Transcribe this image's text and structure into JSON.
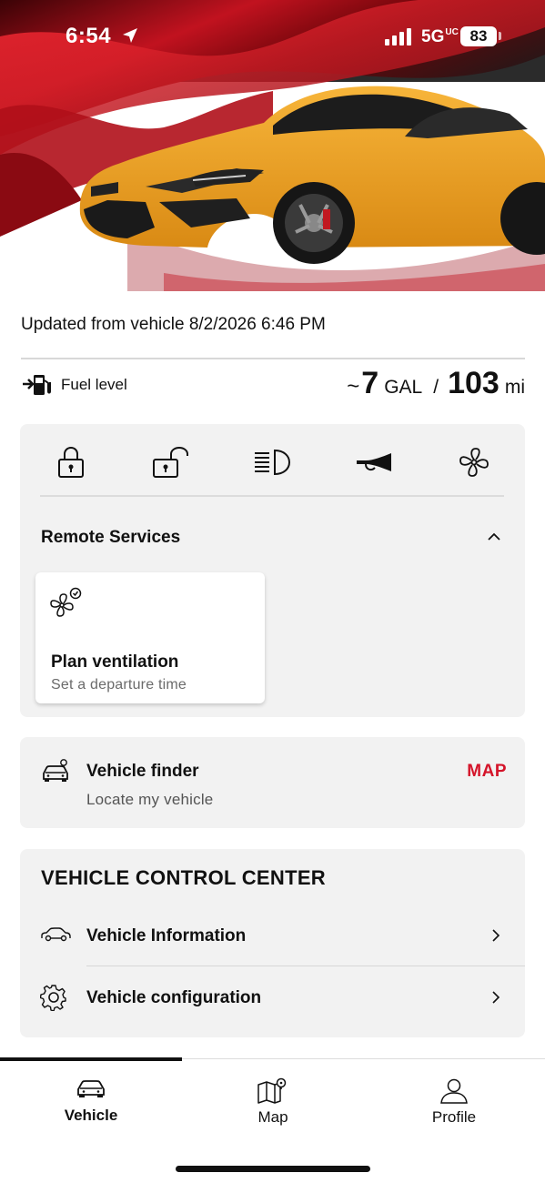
{
  "status_bar": {
    "time": "6:54",
    "network": "5G",
    "network_suffix": "UC",
    "battery": "83"
  },
  "hero": {
    "car_color": "#f2a420",
    "accent_color": "#d4142a"
  },
  "vehicle": {
    "updated_text": "Updated from vehicle 8/2/2026 6:46 PM",
    "fuel_label": "Fuel level",
    "fuel_tilde": "~",
    "fuel_gallons": "7",
    "fuel_gallons_unit": "GAL",
    "fuel_slash": "/",
    "range_miles": "103",
    "range_unit": "mi"
  },
  "quick_actions": [
    {
      "icon": "lock-icon"
    },
    {
      "icon": "unlock-icon"
    },
    {
      "icon": "headlights-icon"
    },
    {
      "icon": "horn-icon"
    },
    {
      "icon": "fan-icon"
    }
  ],
  "remote_services": {
    "title": "Remote Services",
    "plan_title": "Plan ventilation",
    "plan_subtitle": "Set a departure time"
  },
  "vehicle_finder": {
    "title": "Vehicle finder",
    "subtitle": "Locate my vehicle",
    "map_label": "MAP"
  },
  "control_center": {
    "title": "VEHICLE CONTROL CENTER",
    "rows": [
      {
        "label": "Vehicle Information",
        "icon": "car-outline-icon"
      },
      {
        "label": "Vehicle configuration",
        "icon": "gear-icon"
      }
    ]
  },
  "nav": {
    "tabs": [
      {
        "label": "Vehicle",
        "icon": "car-icon",
        "active": true
      },
      {
        "label": "Map",
        "icon": "map-icon",
        "active": false
      },
      {
        "label": "Profile",
        "icon": "profile-icon",
        "active": false
      }
    ]
  }
}
